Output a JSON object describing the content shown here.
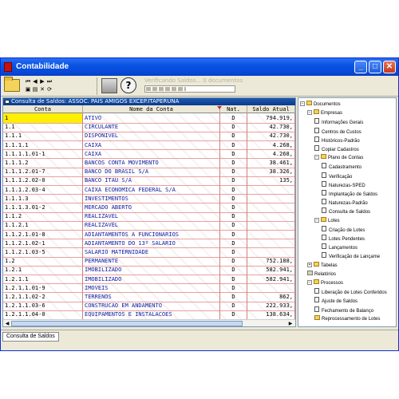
{
  "window": {
    "title": "Contabilidade",
    "controls": {
      "minimize": "_",
      "maximize": "□",
      "close": "✕"
    }
  },
  "toolbar": {
    "progress_label": "Verificando Saldos... 0 documentos",
    "progress_fraction": 0.45,
    "help_glyph": "?"
  },
  "consulta": {
    "title": "Consulta de Saldos: ASSOC. PAIS AMIGOS EXCEP.ITAPERUNA",
    "columns": [
      "Conta",
      "Nome da Conta",
      "Nat.",
      "Saldo Atual"
    ],
    "rows": [
      {
        "conta": "1",
        "nome": "ATIVO",
        "nat": "D",
        "saldo": "794.919,"
      },
      {
        "conta": "1.1",
        "nome": "CIRCULANTE",
        "nat": "D",
        "saldo": "42.730,"
      },
      {
        "conta": "1.1.1",
        "nome": "DISPONIVEL",
        "nat": "D",
        "saldo": "42.730,"
      },
      {
        "conta": "1.1.1.1",
        "nome": "CAIXA",
        "nat": "D",
        "saldo": "4.268,"
      },
      {
        "conta": "1.1.1.1.01-1",
        "nome": "CAIXA",
        "nat": "D",
        "saldo": "4.268,"
      },
      {
        "conta": "1.1.1.2",
        "nome": "BANCOS CONTA MOVIMENTO",
        "nat": "D",
        "saldo": "38.461,"
      },
      {
        "conta": "1.1.1.2.01-7",
        "nome": "BANCO DO BRASIL S/A",
        "nat": "D",
        "saldo": "38.326,"
      },
      {
        "conta": "1.1.1.2.02-0",
        "nome": "BANCO ITAU S/A",
        "nat": "D",
        "saldo": "135,"
      },
      {
        "conta": "1.1.1.2.03-4",
        "nome": "CAIXA ECONOMICA FEDERAL S/A",
        "nat": "D",
        "saldo": ""
      },
      {
        "conta": "1.1.1.3",
        "nome": "INVESTIMENTOS",
        "nat": "D",
        "saldo": ""
      },
      {
        "conta": "1.1.1.3.01-2",
        "nome": "MERCADO ABERTO",
        "nat": "D",
        "saldo": ""
      },
      {
        "conta": "1.1.2",
        "nome": "REALIZAVEL",
        "nat": "D",
        "saldo": ""
      },
      {
        "conta": "1.1.2.1",
        "nome": "REALIZAVEL",
        "nat": "D",
        "saldo": ""
      },
      {
        "conta": "1.1.2.1.01-8",
        "nome": "ADIANTAMENTOS A FUNCIONARIOS",
        "nat": "D",
        "saldo": ""
      },
      {
        "conta": "1.1.2.1.02-1",
        "nome": "ADIANTAMENTO DO 13º SALARIO",
        "nat": "D",
        "saldo": ""
      },
      {
        "conta": "1.1.2.1.03-5",
        "nome": "SALARIO MATERNIDADE",
        "nat": "D",
        "saldo": ""
      },
      {
        "conta": "1.2",
        "nome": "PERMANENTE",
        "nat": "D",
        "saldo": "752.188,"
      },
      {
        "conta": "1.2.1",
        "nome": "IMOBILIZADO",
        "nat": "D",
        "saldo": "582.941,"
      },
      {
        "conta": "1.2.1.1",
        "nome": "IMOBILIZADO",
        "nat": "D",
        "saldo": "582.941,"
      },
      {
        "conta": "1.2.1.1.01-9",
        "nome": "IMOVEIS",
        "nat": "D",
        "saldo": ""
      },
      {
        "conta": "1.2.1.1.02-2",
        "nome": "TERRENOS",
        "nat": "D",
        "saldo": "862,"
      },
      {
        "conta": "1.2.1.1.03-6",
        "nome": "CONSTRUCAO EM ANDAMENTO",
        "nat": "D",
        "saldo": "222.933,"
      },
      {
        "conta": "1.2.1.1.04-0",
        "nome": "EQUIPAMENTOS E INSTALACOES",
        "nat": "D",
        "saldo": "138.634,"
      }
    ]
  },
  "tree": {
    "nodes": [
      {
        "label": "Documentos",
        "icon": "expander-minus",
        "kind": "folder"
      },
      {
        "label": "Empresas",
        "icon": "expander-minus",
        "kind": "folder"
      },
      {
        "label": "Informações Gerais",
        "icon": "doc",
        "kind": "doc"
      },
      {
        "label": "Centros de Custos",
        "icon": "doc",
        "kind": "doc"
      },
      {
        "label": "Históricos-Padrão",
        "icon": "doc",
        "kind": "doc"
      },
      {
        "label": "Copiar Cadastros",
        "icon": "doc",
        "kind": "doc"
      },
      {
        "label": "Plano de Contas",
        "icon": "expander-minus",
        "kind": "folder"
      },
      {
        "label": "Cadastramento",
        "icon": "doc",
        "kind": "doc"
      },
      {
        "label": "Verificação",
        "icon": "doc",
        "kind": "doc"
      },
      {
        "label": "Naturezas-SPED",
        "icon": "doc",
        "kind": "doc"
      },
      {
        "label": "Implantação de Saldos",
        "icon": "doc",
        "kind": "doc"
      },
      {
        "label": "Naturezas-Padrão",
        "icon": "doc",
        "kind": "doc"
      },
      {
        "label": "Consulta de Saldos",
        "icon": "doc",
        "kind": "doc"
      },
      {
        "label": "Lotes",
        "icon": "expander-minus",
        "kind": "folder"
      },
      {
        "label": "Criação de Lotes",
        "icon": "doc",
        "kind": "doc"
      },
      {
        "label": "Lotes Pendentes",
        "icon": "doc",
        "kind": "doc"
      },
      {
        "label": "Lançamentos",
        "icon": "doc",
        "kind": "doc"
      },
      {
        "label": "Verificação de Lançame",
        "icon": "doc",
        "kind": "doc"
      },
      {
        "label": "Tabelas",
        "icon": "expander-plus",
        "kind": "folder"
      },
      {
        "label": "Relatórios",
        "icon": "report",
        "kind": "report"
      },
      {
        "label": "Processos",
        "icon": "expander-minus",
        "kind": "folder"
      },
      {
        "label": "Liberação de Lotes Conferidos",
        "icon": "doc",
        "kind": "doc"
      },
      {
        "label": "Ajuste de Saldos",
        "icon": "doc",
        "kind": "doc"
      },
      {
        "label": "Fechamento de Balanço",
        "icon": "doc",
        "kind": "doc"
      },
      {
        "label": "Reprocessamento de Lotes",
        "icon": "folder",
        "kind": "folder"
      }
    ]
  },
  "statusbar": {
    "tab_label": "Consulta de Saldos"
  }
}
